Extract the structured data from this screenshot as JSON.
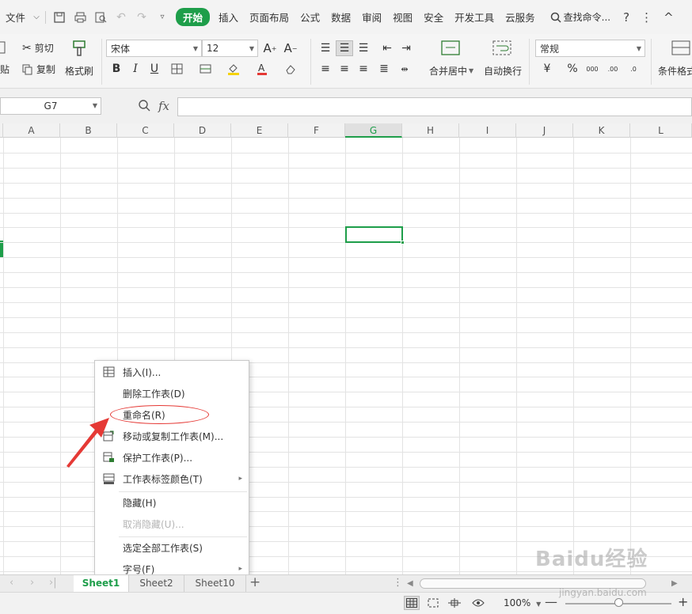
{
  "menubar": {
    "file_partial": "文件",
    "items": [
      "插入",
      "页面布局",
      "公式",
      "数据",
      "审阅",
      "视图",
      "安全",
      "开发工具",
      "云服务"
    ],
    "start": "开始",
    "search": "查找命令...",
    "help": "?",
    "more": "⋮",
    "collapse": "^"
  },
  "ribbon": {
    "paste_partial": "贴",
    "cut": "剪切",
    "copy": "复制",
    "format_painter": "格式刷",
    "font_name": "宋体",
    "font_size": "12",
    "merge_center": "合并居中",
    "wrap_text": "自动换行",
    "number_format": "常规",
    "cond_format_partial": "条件格式"
  },
  "formula": {
    "name_box": "G7",
    "fx": "fx",
    "content": ""
  },
  "grid": {
    "columns": [
      "A",
      "B",
      "C",
      "D",
      "E",
      "F",
      "G",
      "H",
      "I",
      "J",
      "K",
      "L"
    ],
    "active_column": "G"
  },
  "context_menu": {
    "items": [
      {
        "label": "插入(I)...",
        "icon": "insert-sheet-icon"
      },
      {
        "label": "删除工作表(D)",
        "icon": ""
      },
      {
        "label": "重命名(R)",
        "icon": ""
      },
      {
        "label": "移动或复制工作表(M)...",
        "icon": "move-copy-sheet-icon"
      },
      {
        "label": "保护工作表(P)...",
        "icon": "protect-sheet-icon"
      },
      {
        "label": "工作表标签颜色(T)",
        "icon": "tab-color-icon"
      },
      {
        "label": "隐藏(H)",
        "icon": ""
      },
      {
        "label": "取消隐藏(U)...",
        "icon": ""
      },
      {
        "label": "选定全部工作表(S)",
        "icon": ""
      },
      {
        "label": "字号(F)",
        "icon": ""
      }
    ]
  },
  "sheets": {
    "tabs": [
      "Sheet1",
      "Sheet2",
      "Sheet10"
    ],
    "active": "Sheet1",
    "add": "+"
  },
  "status": {
    "zoom": "100%",
    "minus": "—",
    "plus": "+"
  },
  "watermark": {
    "brand": "Baidu经验",
    "url": "jingyan.baidu.com"
  },
  "colors": {
    "accent": "#1e9e4a",
    "annotation": "#e53935"
  }
}
